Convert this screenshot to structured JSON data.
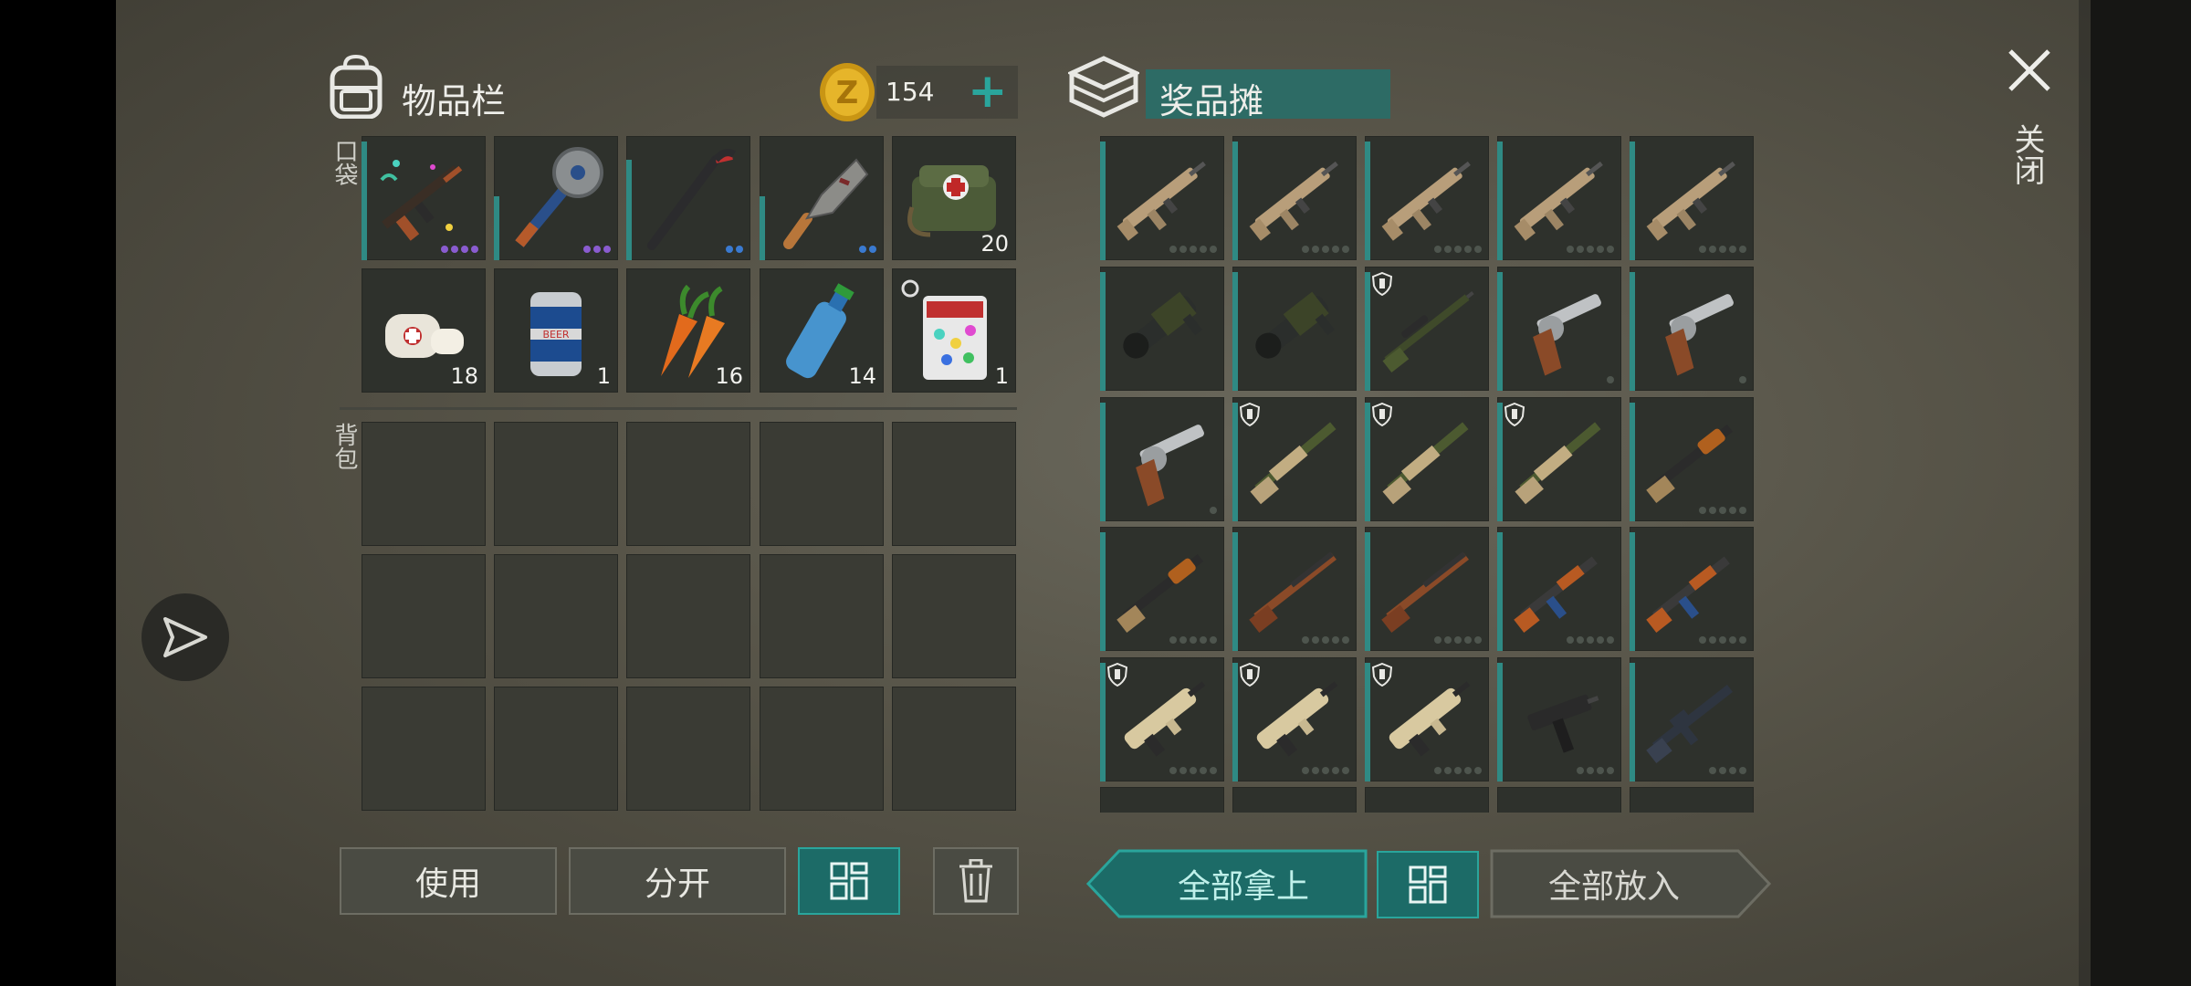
{
  "inventory": {
    "title": "物品栏",
    "coins": "154",
    "add_symbol": "+",
    "pocket_label": "口袋",
    "backpack_label": "背包",
    "pocket_slots": [
      {
        "item": "rifle-confetti-ak",
        "qty": "",
        "dots": "purple"
      },
      {
        "item": "saw-club",
        "qty": "",
        "dots": "purple3"
      },
      {
        "item": "crowbar",
        "qty": "",
        "dots": "blue2"
      },
      {
        "item": "cleaver",
        "qty": "",
        "dots": "blue2"
      },
      {
        "item": "first-aid-bag",
        "qty": "20",
        "dots": ""
      },
      {
        "item": "bandage",
        "qty": "18",
        "dots": ""
      },
      {
        "item": "beer-can",
        "qty": "1",
        "dots": ""
      },
      {
        "item": "carrots",
        "qty": "16",
        "dots": ""
      },
      {
        "item": "water-bottle",
        "qty": "14",
        "dots": ""
      },
      {
        "item": "confetti-pack",
        "qty": "1",
        "dots": ""
      }
    ]
  },
  "loot": {
    "title": "奖品摊",
    "rows": [
      [
        "scar-rifle",
        "scar-rifle",
        "scar-rifle",
        "scar-rifle",
        "scar-rifle"
      ],
      [
        "grenade-launcher",
        "grenade-launcher",
        "sniper-rifle",
        "revolver",
        "revolver"
      ],
      [
        "revolver",
        "shotgun",
        "shotgun",
        "shotgun",
        "pump-shotgun"
      ],
      [
        "pump-shotgun",
        "lever-rifle",
        "lever-rifle",
        "ak-rifle",
        "ak-rifle"
      ],
      [
        "bullpup-rifle",
        "bullpup-rifle",
        "bullpup-rifle",
        "uzi",
        "m16-rifle"
      ]
    ]
  },
  "buttons": {
    "use": "使用",
    "split": "分开",
    "take_all": "全部拿上",
    "put_all": "全部放入",
    "close_label": "关闭"
  },
  "colors": {
    "accent": "#1c6b67",
    "accent_border": "#2aa59c",
    "slot_bg": "#2e312c"
  }
}
